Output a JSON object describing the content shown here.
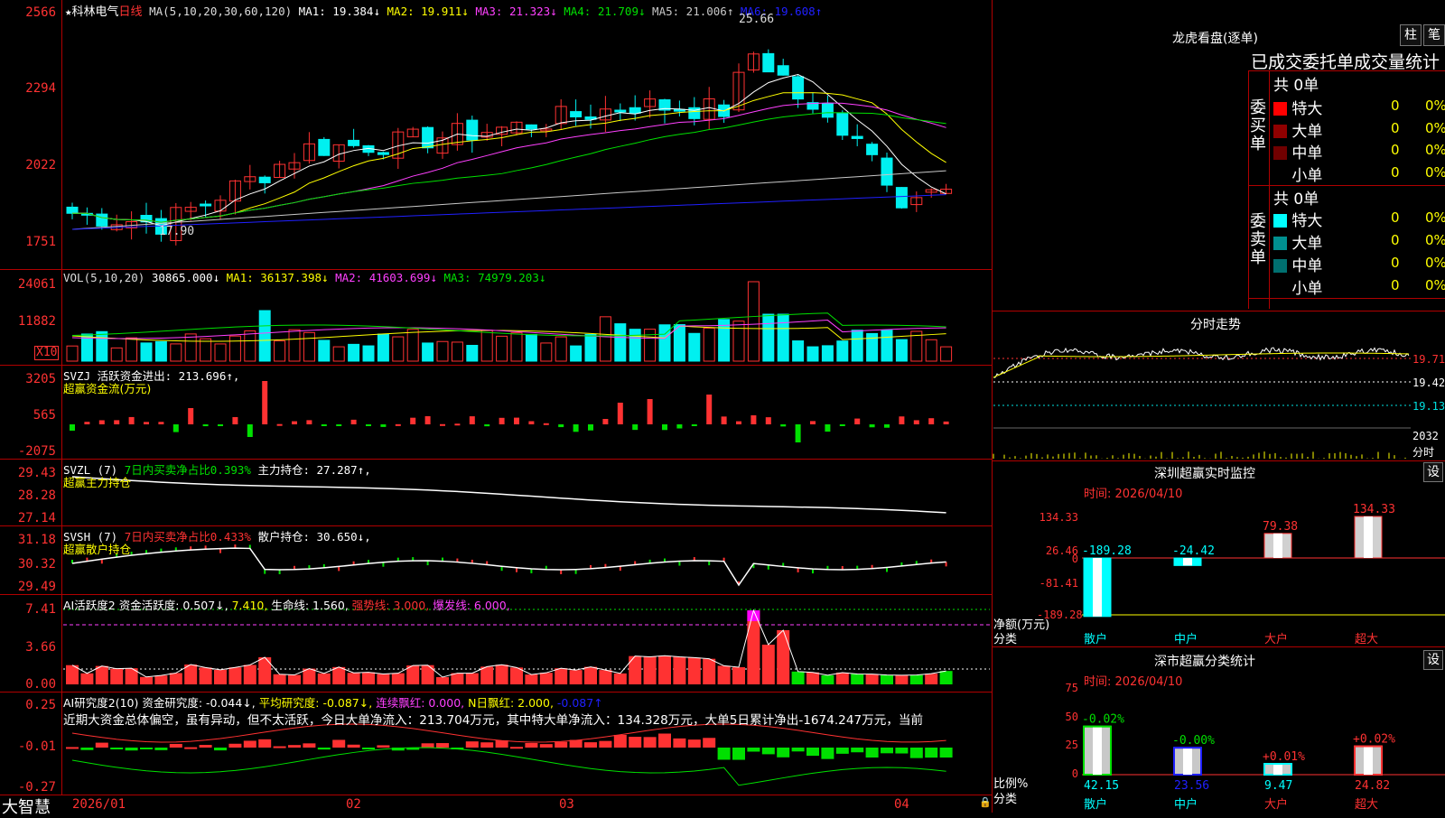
{
  "app": {
    "stock_name": "科林电气",
    "period": "日线",
    "star": "★",
    "logo": "大智慧"
  },
  "colors": {
    "up": "#ff3232",
    "down": "#00f0f0",
    "frame": "#b00000",
    "green": "#00e000"
  },
  "main_legend": {
    "ma_name": "MA(5,10,20,30,60,120)",
    "ma1": "MA1: 19.384↓",
    "ma2": "MA2: 19.911↓",
    "ma3": "MA3: 21.323↓",
    "ma4": "MA4: 21.709↓",
    "ma5": "MA5: 21.006↑",
    "ma6": "MA6: 19.608↑"
  },
  "main_axis": {
    "t1": "2566",
    "t2": "2294",
    "t3": "2022",
    "t4": "1751"
  },
  "main_ann": {
    "high": "25.66",
    "low": "17.90"
  },
  "vol_legend": {
    "name": "VOL(5,10,20)",
    "v": "30865.000↓",
    "ma1": "MA1: 36137.398↓",
    "ma2": "MA2: 41603.699↓",
    "ma3": "MA3: 74979.203↓"
  },
  "vol_axis": {
    "t1": "24061",
    "t2": "11882",
    "unit": "X10"
  },
  "svzj": {
    "name": "SVZJ  活跃资金进出: 213.696↑,",
    "sub": "超赢资金流(万元)",
    "t1": "3205",
    "t2": "565",
    "t3": "-2075"
  },
  "svzl": {
    "name": "SVZL (7)",
    "l1": "7日内买卖净占比0.393%",
    "l2": "主力持仓: 27.287↑,",
    "sub": "超赢主力持仓",
    "t1": "29.43",
    "t2": "28.28",
    "t3": "27.14"
  },
  "svsh": {
    "name": "SVSH (7)",
    "l1": "7日内买卖净占比0.433%",
    "l2": "散户持仓: 30.650↓,",
    "sub": "超赢散户持仓",
    "t1": "31.18",
    "t2": "30.32",
    "t3": "29.49"
  },
  "ai1": {
    "name": "AI活跃度2",
    "l1": "资金活跃度: 0.507↓,",
    "l2": "7.410,",
    "l3": "生命线: 1.560,",
    "l4": "强势线: 3.000,",
    "l5": "爆发线: 6.000,",
    "t1": "7.41",
    "t2": "3.66",
    "t3": "0.00"
  },
  "ai2": {
    "name": "AI研究度2(10)",
    "l1": "资金研究度: -0.044↓,",
    "l2": "平均研究度: -0.087↓,",
    "l3": "连续飘红: 0.000,",
    "l4": "N日飘红: 2.000,",
    "l5": "-0.087↑",
    "t1": "0.25",
    "t2": "-0.01",
    "t3": "-0.27",
    "note": "近期大资金总体偏空，虽有异动，但不太活跃，今日大单净流入：213.704万元，其中特大单净流入：134.328万元，大单5日累计净出-1674.247万元，当前"
  },
  "date_axis": {
    "d1": "2026/01",
    "d2": "02",
    "d3": "03",
    "d4": "04"
  },
  "lhb": {
    "title": "龙虎看盘(逐单)",
    "btn1": "柱",
    "btn2": "笔",
    "subtitle": "已成交委托单成交量统计",
    "buy_label": "委买单",
    "sell_label": "委卖单",
    "buy_total": "共 0单",
    "sell_total": "共 0单",
    "rows": [
      {
        "name": "特大",
        "v": "0",
        "p": "0%"
      },
      {
        "name": "大单",
        "v": "0",
        "p": "0%"
      },
      {
        "name": "中单",
        "v": "0",
        "p": "0%"
      },
      {
        "name": "小单",
        "v": "0",
        "p": "0%"
      }
    ],
    "sell_rows": [
      {
        "name": "特大",
        "v": "0",
        "p": "0%"
      },
      {
        "name": "大单",
        "v": "0",
        "p": "0%"
      },
      {
        "name": "中单",
        "v": "0",
        "p": "0%"
      },
      {
        "name": "小单",
        "v": "0",
        "p": "0%"
      }
    ]
  },
  "intraday": {
    "title": "分时走势",
    "t1": "19.71",
    "t2": "19.42",
    "t3": "19.13",
    "t4": "2032",
    "t5": "分时"
  },
  "sz_monitor": {
    "title": "深圳超赢实时监控",
    "btn": "设",
    "time": "时间: 2026/04/10",
    "y1": "134.33",
    "y2": "26.46",
    "y3": "0",
    "y4": "-81.41",
    "y5": "-189.28",
    "ylabel": "净额(万元)",
    "xlabel": "分类",
    "cats": [
      "散户",
      "中户",
      "大户",
      "超大"
    ],
    "vals": [
      "-189.28",
      "-24.42",
      "79.38",
      "134.33"
    ]
  },
  "sz_class": {
    "title": "深市超赢分类统计",
    "btn": "设",
    "time": "时间: 2026/04/10",
    "y1": "75",
    "y2": "50",
    "y3": "25",
    "y4": "0",
    "ylabel": "比例%",
    "xlabel": "分类",
    "cats": [
      "散户",
      "中户",
      "大户",
      "超大"
    ],
    "vals": [
      "42.15",
      "23.56",
      "9.47",
      "24.82"
    ],
    "chg": [
      "-0.02%",
      "-0.00%",
      "+0.01%",
      "+0.02%"
    ]
  }
}
